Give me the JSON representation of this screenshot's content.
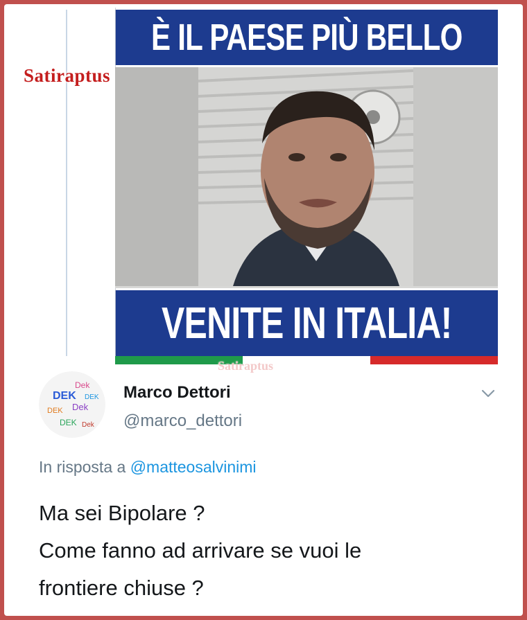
{
  "watermark": "Satiraptus",
  "media": {
    "top_banner": "È IL PAESE PIÙ BELLO",
    "bottom_banner": "VENITE IN ITALIA!",
    "colors": {
      "banner_blue": "#1d3b8f",
      "flag_green": "#1f9a4a",
      "flag_white": "#ffffff",
      "flag_red": "#d62a2a"
    }
  },
  "tweet": {
    "author_name": "Marco Dettori",
    "author_handle": "@marco_dettori",
    "reply_prefix": "In risposta a",
    "reply_to": "@matteosalvinimi",
    "text_lines": [
      "Ma sei Bipolare ?",
      "Come fanno ad arrivare se vuoi le",
      "frontiere chiuse ?"
    ],
    "menu_icon": "chevron-down-icon"
  },
  "colors": {
    "frame_border": "#c0504d",
    "thread_line": "#c8d6e5",
    "link_blue": "#1b95e0",
    "secondary_gray": "#657786"
  }
}
